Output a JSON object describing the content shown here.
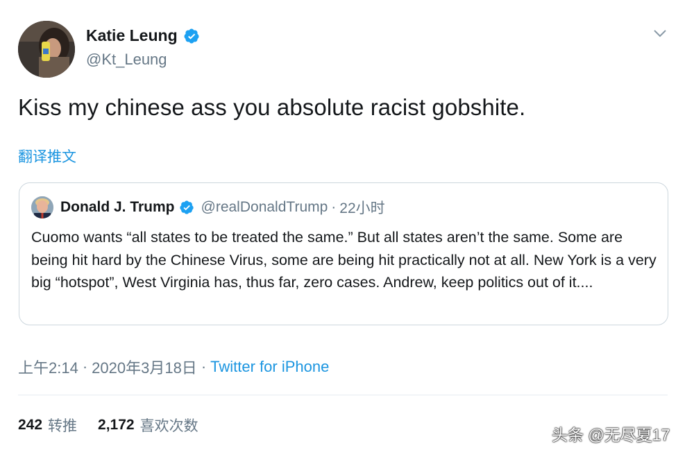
{
  "author": {
    "display_name": "Katie Leung",
    "handle": "@Kt_Leung"
  },
  "tweet_text": "Kiss my chinese ass you absolute racist gobshite.",
  "translate_label": "翻译推文",
  "quoted_tweet": {
    "display_name": "Donald J. Trump",
    "handle": "@realDonaldTrump",
    "separator": "·",
    "time": "22小时",
    "text": "Cuomo wants “all states to be treated the same.” But all states aren’t the same. Some are being hit hard by the Chinese Virus, some are being hit practically not at all. New York is a very big “hotspot”, West Virginia has, thus far, zero cases. Andrew, keep politics out of it...."
  },
  "meta": {
    "time": "上午2:14",
    "separator": "·",
    "date": "2020年3月18日",
    "source": "Twitter for iPhone"
  },
  "stats": {
    "retweets_count": "242",
    "retweets_label": "转推",
    "likes_count": "2,172",
    "likes_label": "喜欢次数"
  },
  "watermark": "头条 @无尽夏17",
  "colors": {
    "link_blue": "#1b95e0",
    "verified_blue": "#1da1f2",
    "secondary_text": "#657786",
    "border": "#ccd6dd"
  }
}
